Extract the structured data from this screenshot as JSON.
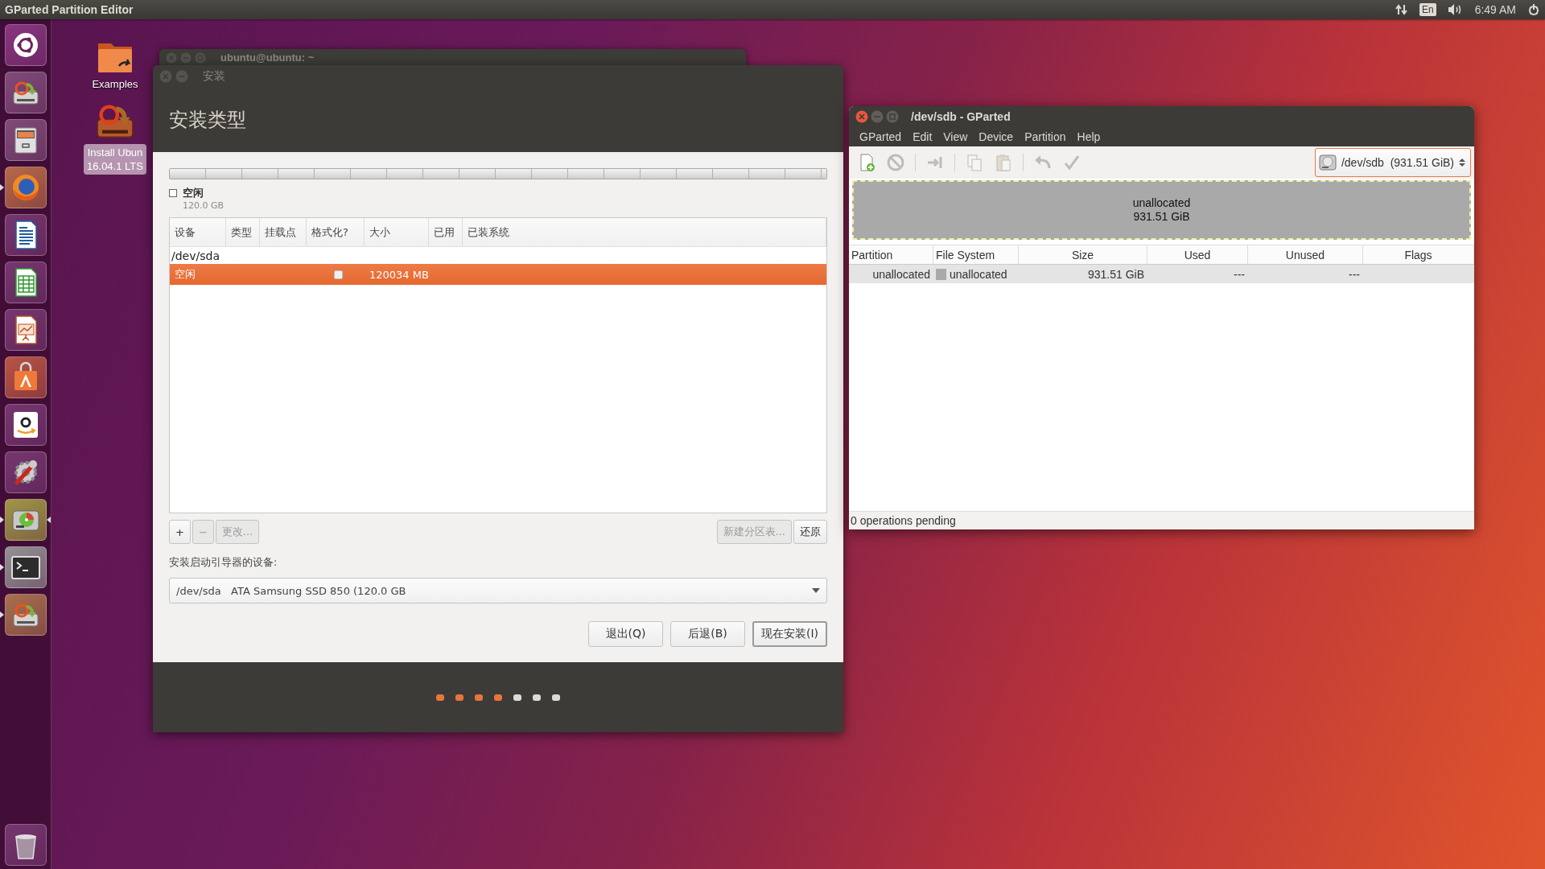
{
  "top_panel": {
    "app_title": "GParted Partition Editor",
    "keyboard_layout": "En",
    "clock": "6:49 AM"
  },
  "launcher": {
    "items": [
      {
        "kind": "dash",
        "running": false,
        "focused": false
      },
      {
        "kind": "installer",
        "running": false,
        "focused": false
      },
      {
        "kind": "files",
        "running": false,
        "focused": false
      },
      {
        "kind": "browser",
        "running": true,
        "focused": false
      },
      {
        "kind": "writer",
        "running": false,
        "focused": false
      },
      {
        "kind": "calc",
        "running": false,
        "focused": false
      },
      {
        "kind": "impress",
        "running": false,
        "focused": false
      },
      {
        "kind": "software",
        "running": false,
        "focused": false
      },
      {
        "kind": "shop",
        "running": false,
        "focused": false
      },
      {
        "kind": "settings",
        "running": false,
        "focused": false
      },
      {
        "kind": "gparted",
        "running": true,
        "focused": true
      },
      {
        "kind": "terminal",
        "running": true,
        "focused": false
      },
      {
        "kind": "installer-active",
        "running": true,
        "focused": false
      },
      {
        "kind": "trash",
        "running": false,
        "focused": false
      }
    ]
  },
  "desktop_icons": [
    {
      "kind": "folder",
      "label_lines": [
        "Examples"
      ],
      "selected": false
    },
    {
      "kind": "installer",
      "label_lines": [
        "Install Ubun",
        "16.04.1 LTS"
      ],
      "selected": true
    }
  ],
  "terminal_window": {
    "title": "ubuntu@ubuntu: ~",
    "focused": false
  },
  "installer": {
    "title": "安装",
    "focused": false,
    "heading": "安装类型",
    "legend": {
      "label": "空闲",
      "size": "120.0 GB",
      "checked": false
    },
    "columns": [
      "设备",
      "类型",
      "挂载点",
      "格式化?",
      "大小",
      "已用",
      "已装系统"
    ],
    "rows": [
      {
        "kind": "device",
        "device": "/dev/sda",
        "selected": false
      },
      {
        "kind": "partition",
        "device": "空闲",
        "format_checked": false,
        "size": "120034 MB",
        "selected": true
      }
    ],
    "edit_buttons": [
      {
        "label": "+",
        "disabled": false
      },
      {
        "label": "−",
        "disabled": true
      },
      {
        "label": "更改...",
        "disabled": true
      }
    ],
    "table_buttons": [
      {
        "label": "新建分区表...",
        "disabled": true
      },
      {
        "label": "还原",
        "disabled": false
      }
    ],
    "bootloader_label": "安装启动引导器的设备:",
    "bootloader_device": "/dev/sda   ATA Samsung SSD 850 (120.0 GB",
    "nav_buttons": [
      {
        "label": "退出(Q)",
        "default": false
      },
      {
        "label": "后退(B)",
        "default": false
      },
      {
        "label": "现在安装(I)",
        "default": true
      }
    ],
    "steps": [
      {
        "done": true
      },
      {
        "done": true
      },
      {
        "done": true
      },
      {
        "done": true
      },
      {
        "done": false
      },
      {
        "done": false
      },
      {
        "done": false
      }
    ]
  },
  "gparted": {
    "title": "/dev/sdb - GParted",
    "focused": true,
    "menu": [
      "GParted",
      "Edit",
      "View",
      "Device",
      "Partition",
      "Help"
    ],
    "toolbar": [
      {
        "kind": "new",
        "disabled": false,
        "separator_after": false
      },
      {
        "kind": "delete",
        "disabled": true,
        "separator_after": true
      },
      {
        "kind": "resize",
        "disabled": true,
        "separator_after": true
      },
      {
        "kind": "copy",
        "disabled": true,
        "separator_after": false
      },
      {
        "kind": "paste",
        "disabled": true,
        "separator_after": true
      },
      {
        "kind": "undo",
        "disabled": true,
        "separator_after": false
      },
      {
        "kind": "apply",
        "disabled": true,
        "separator_after": false
      }
    ],
    "device_select": "/dev/sdb  (931.51 GiB)",
    "disk_map": {
      "label": "unallocated",
      "size": "931.51 GiB"
    },
    "columns": [
      "Partition",
      "File System",
      "Size",
      "Used",
      "Unused",
      "Flags"
    ],
    "rows": [
      {
        "partition": "unallocated",
        "file_system": "unallocated",
        "color": "#a9a9a9",
        "size": "931.51 GiB",
        "used": "---",
        "unused": "---",
        "selected": true
      }
    ],
    "status": "0 operations pending"
  }
}
